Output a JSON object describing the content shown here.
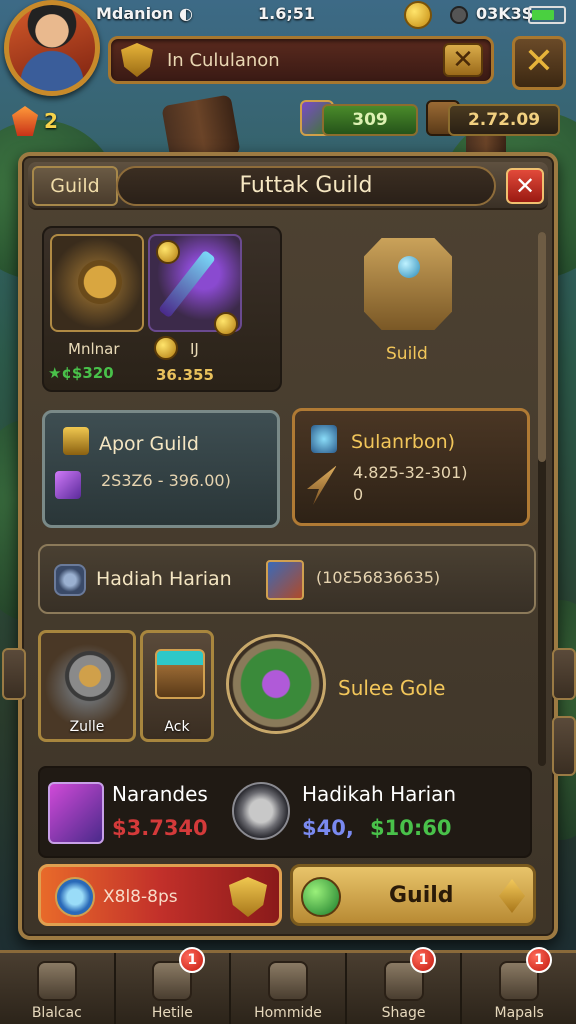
{
  "status_bar": {
    "carrier": "Mdanion ◐",
    "time": "1.6;51",
    "network": "03K3S"
  },
  "header": {
    "search_text": "In Cululanon",
    "gem_count": "2",
    "green_resource": "309",
    "gold_resource": "2.72.09"
  },
  "panel": {
    "tab_label": "Guild",
    "title": "Futtak Guild",
    "items": [
      {
        "label": "Mnlnar",
        "value": "★¢$320",
        "value_color": "#49c14a"
      },
      {
        "label": "IJ",
        "value": "36.355",
        "value_color": "#e9c15c"
      }
    ],
    "guild_label": "Suild",
    "cards": [
      {
        "title": "Apor Guild",
        "subtitle": "2S3Z6 - 396.00)"
      },
      {
        "title": "Sulanrbon)",
        "subtitle": "4.825-32-301)",
        "subtitle2": "0"
      }
    ],
    "daily_row": {
      "title": "Hadiah Harian",
      "value": "(10Ɛ56836635)"
    },
    "tiles": [
      {
        "label": "Zulle"
      },
      {
        "label": "Ack"
      }
    ],
    "orb_label": "Sulee Gole",
    "strip": {
      "left_title": "Narandes",
      "left_value": "$3.7340",
      "right_title": "Hadikah Harian",
      "right_value_a": "$40,",
      "right_value_b": "$10:60"
    },
    "buttons": {
      "red_label": "X8l8-8ps",
      "gold_label": "Guild"
    }
  },
  "bottom_nav": [
    {
      "label": "Blalcac",
      "badge": ""
    },
    {
      "label": "Hetile",
      "badge": "1"
    },
    {
      "label": "Hommide",
      "badge": ""
    },
    {
      "label": "Shage",
      "badge": "1"
    },
    {
      "label": "Mapals",
      "badge": "1"
    }
  ],
  "colors": {
    "accent_gold": "#c9a24a",
    "panel_bg": "#4a3e30",
    "close_red": "#d2352a",
    "green_text": "#49c14a"
  }
}
